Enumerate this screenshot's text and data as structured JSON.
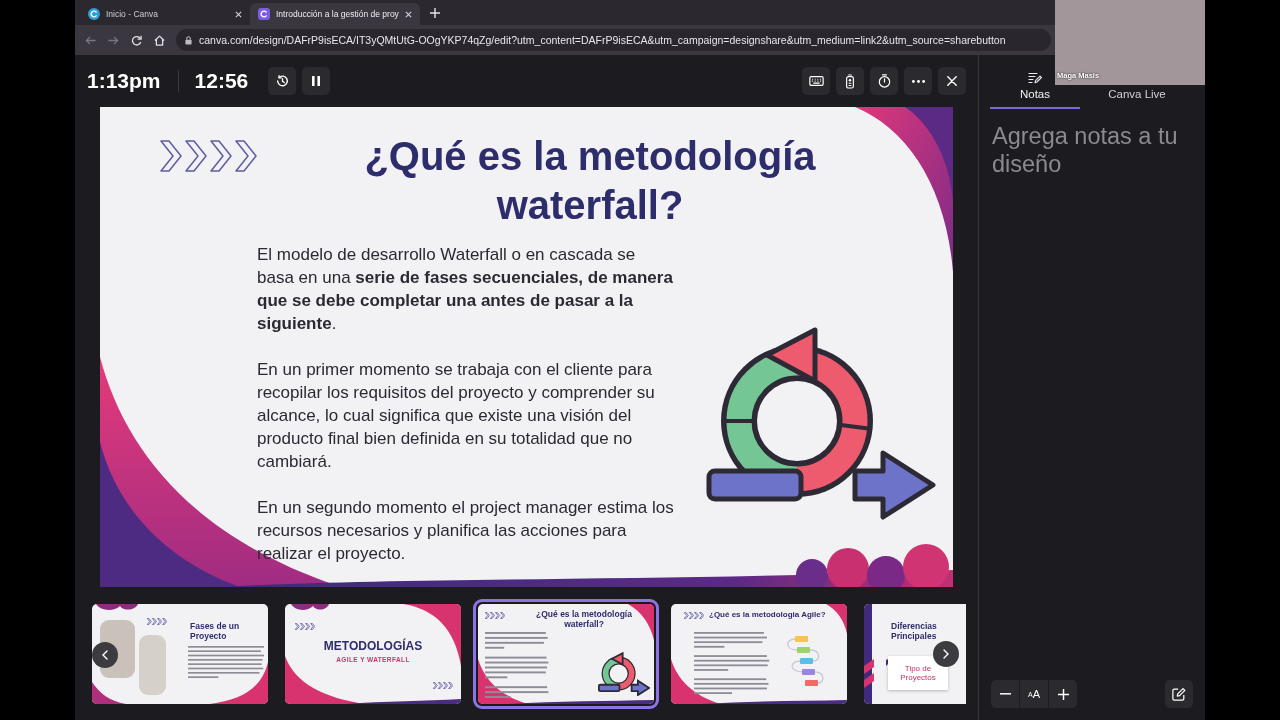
{
  "browser": {
    "tabs": [
      {
        "title": "Inicio - Canva",
        "selected": false
      },
      {
        "title": "Introducción a la gestión de proy",
        "selected": true
      }
    ],
    "back": {
      "disabled": true
    },
    "forward": {
      "disabled": true
    },
    "url": "canva.com/design/DAFrP9isECA/IT3yQMtUtG-OOgYKP74qZg/edit?utm_content=DAFrP9isECA&utm_campaign=designshare&utm_medium=link2&utm_source=sharebutton"
  },
  "webcam": {
    "name": "Maga Masis"
  },
  "toolbar": {
    "clock": "1:13pm",
    "timer": "12:56"
  },
  "slide": {
    "title": "¿Qué es la metodología waterfall?",
    "paragraphs": [
      "El modelo de desarrollo Waterfall o en cascada se basa en una **serie de fases secuenciales, de manera que se debe completar una antes de pasar a la siguiente**.",
      "En un primer momento se trabaja con el cliente para recopilar los requisitos del proyecto y comprender su alcance, lo cual significa que existe una visión del producto final bien definida en su totalidad que no cambiará.",
      "En un segundo momento el project manager estima los recursos necesarios y planifica las acciones para realizar el proyecto."
    ]
  },
  "thumbnails": [
    {
      "kind": "photos",
      "title": "Fases de un Proyecto",
      "selected": false
    },
    {
      "kind": "cover",
      "title": "METODOLOGÍAS",
      "subtitle": "AGILE Y WATERFALL",
      "selected": false
    },
    {
      "kind": "cycle",
      "title": "¿Qué es la metodología waterfall?",
      "selected": true
    },
    {
      "kind": "flow",
      "title": "¿Qué es la metodologia Agile?",
      "selected": false
    },
    {
      "kind": "compare",
      "title": "Diferencias Principales",
      "card": "Tipo de Proyectos",
      "selected": false
    }
  ],
  "notes": {
    "tabs": [
      {
        "kind": "notes",
        "label": "Notas",
        "selected": true
      },
      {
        "kind": "live",
        "label": "Canva Live",
        "selected": false
      }
    ],
    "placeholder": "Agrega notas a tu diseño",
    "text_size": {
      "small": "A",
      "large": "A"
    }
  }
}
